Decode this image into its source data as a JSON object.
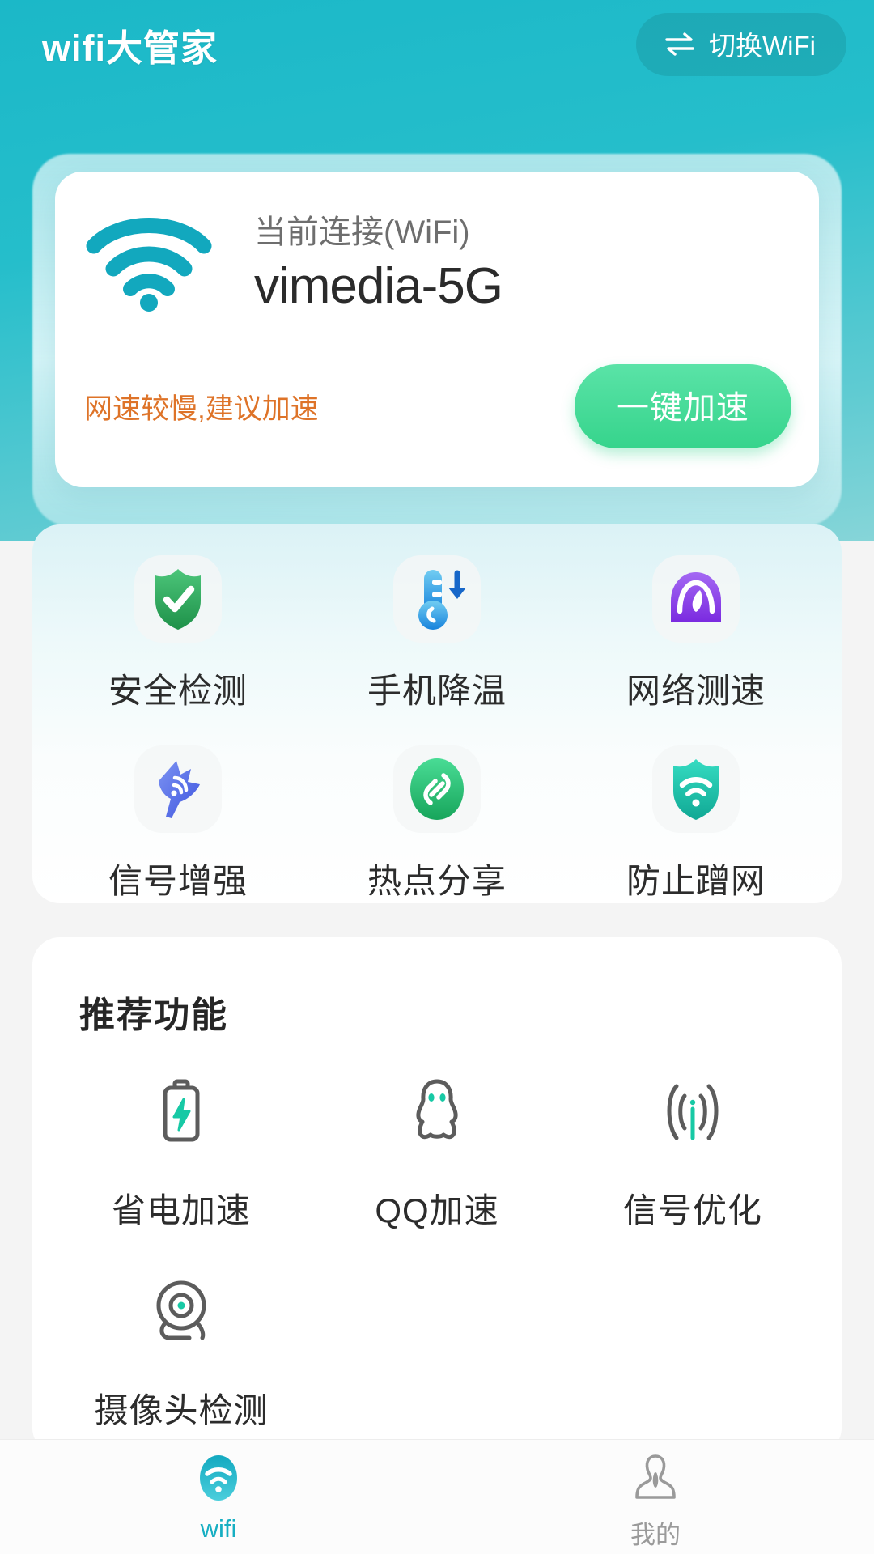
{
  "header": {
    "app_title": "wifi大管家",
    "switch_wifi_label": "切换WiFi",
    "switch_icon": "swap-arrows-icon",
    "background_color": "#1BB8C8"
  },
  "wifi_card": {
    "wifi_icon": "wifi-signal-icon",
    "connected_label": "当前连接(WiFi)",
    "ssid": "vimedia-5G",
    "warning_text": "网速较慢,建议加速",
    "warning_color": "#DE7328",
    "boost_button_label": "一键加速",
    "boost_button_color": "#36D48C"
  },
  "features": {
    "items": [
      {
        "label": "安全检测",
        "icon": "shield-check-icon",
        "color": "#2EA85C"
      },
      {
        "label": "手机降温",
        "icon": "thermometer-cooldown-icon",
        "color": "#2196F3"
      },
      {
        "label": "网络测速",
        "icon": "speedometer-icon",
        "color": "#8B4FE8"
      },
      {
        "label": "信号增强",
        "icon": "satellite-signal-icon",
        "color": "#5570E8"
      },
      {
        "label": "热点分享",
        "icon": "link-chain-icon",
        "color": "#23C475"
      },
      {
        "label": "防止蹭网",
        "icon": "shield-wifi-icon",
        "color": "#1EC8A8"
      }
    ]
  },
  "recommended": {
    "title": "推荐功能",
    "items": [
      {
        "label": "省电加速",
        "icon": "battery-bolt-icon",
        "accent": "#17C9A5"
      },
      {
        "label": "QQ加速",
        "icon": "qq-penguin-icon",
        "accent": "#17C9A5"
      },
      {
        "label": "信号优化",
        "icon": "signal-waves-icon",
        "accent": "#17C9A5"
      },
      {
        "label": "摄像头检测",
        "icon": "webcam-icon",
        "accent": "#17C9A5"
      }
    ]
  },
  "bottom_nav": {
    "items": [
      {
        "label": "wifi",
        "icon": "wifi-tab-icon",
        "active": true
      },
      {
        "label": "我的",
        "icon": "person-tab-icon",
        "active": false
      }
    ],
    "active_color": "#16AEC2",
    "inactive_color": "#9A9A9A"
  }
}
